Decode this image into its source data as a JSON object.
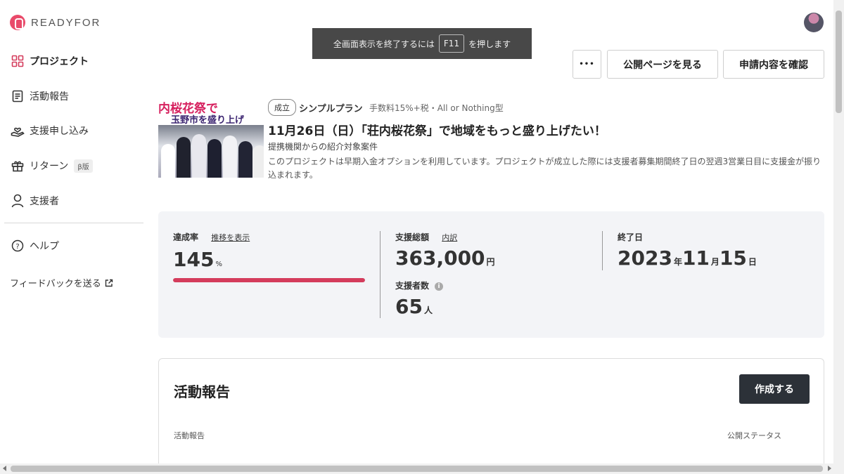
{
  "brand": {
    "name": "READYFOR"
  },
  "sidebar": {
    "items": [
      {
        "label": "プロジェクト",
        "icon": "grid-icon",
        "active": true
      },
      {
        "label": "活動報告",
        "icon": "document-icon",
        "active": false
      },
      {
        "label": "支援申し込み",
        "icon": "hand-heart-icon",
        "active": false
      },
      {
        "label": "リターン",
        "icon": "gift-icon",
        "active": false,
        "badge": "β版"
      },
      {
        "label": "支援者",
        "icon": "person-icon",
        "active": false
      }
    ],
    "help": "ヘルプ",
    "feedback": "フィードバックを送る"
  },
  "toast": {
    "before": "全画面表示を終了するには",
    "key": "F11",
    "after": "を押します"
  },
  "toolbar": {
    "more": "•••",
    "view_public": "公開ページを見る",
    "check_application": "申請内容を確認"
  },
  "project": {
    "thumb_text1": "内桜花祭で",
    "thumb_text2": "玉野市を盛り上げ",
    "status_tag": "成立",
    "plan": "シンプルプラン",
    "fee": "手数料15%+税・All or Nothing型",
    "title": "11月26日（日）「荘内桜花祭」で地域をもっと盛り上げたい！",
    "partner": "提携機関からの紹介対象案件",
    "description": "このプロジェクトは早期入金オプションを利用しています。プロジェクトが成立した際には支援者募集期間終了日の翌週3営業日目に支援金が振り込まれます。"
  },
  "stats": {
    "rate_label": "達成率",
    "rate_link": "推移を表示",
    "rate_value": "145",
    "rate_unit": "%",
    "rate_fraction": 1.0,
    "total_label": "支援総額",
    "total_link": "内訳",
    "total_value": "363,000",
    "total_unit": "円",
    "backers_label": "支援者数",
    "backers_value": "65",
    "backers_unit": "人",
    "end_label": "終了日",
    "end_year": "2023",
    "end_year_unit": "年",
    "end_month": "11",
    "end_month_unit": "月",
    "end_day": "15",
    "end_day_unit": "日"
  },
  "activity": {
    "title": "活動報告",
    "create": "作成する",
    "col_report": "活動報告",
    "col_status": "公開ステータス"
  },
  "colors": {
    "accent": "#d43c5c",
    "dark_button": "#2c3138"
  }
}
